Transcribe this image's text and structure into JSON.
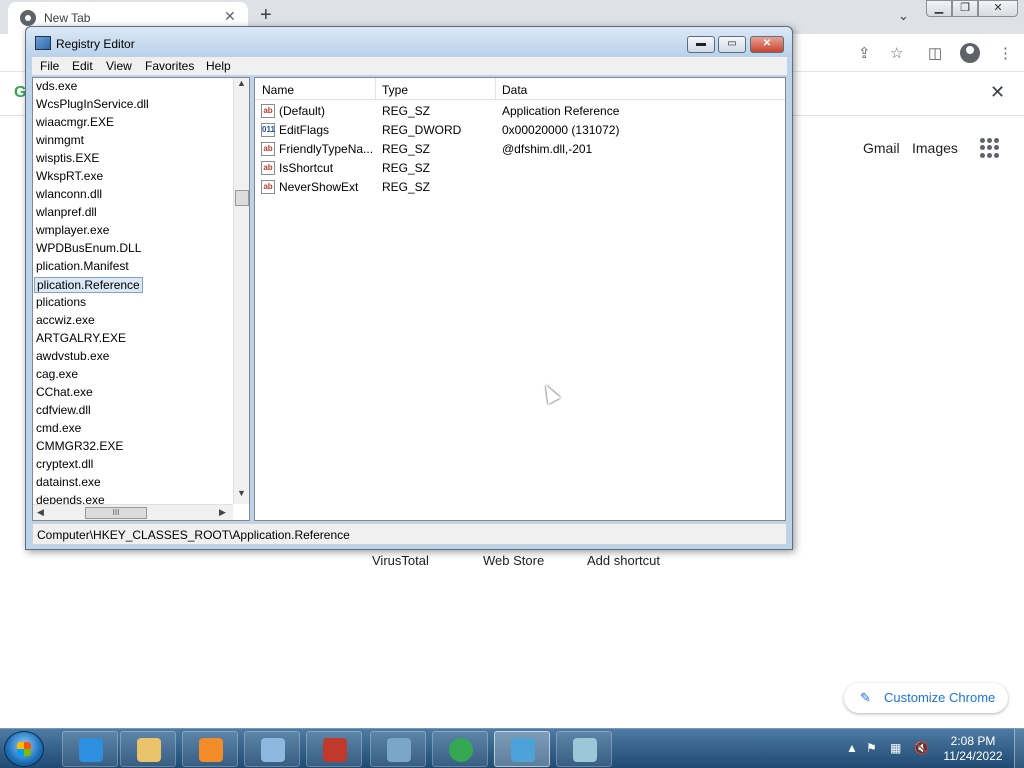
{
  "chrome": {
    "tab_title": "New Tab",
    "tab_close": "✕",
    "new_tab": "+",
    "tab_search": "⌄",
    "win_min": "▁",
    "win_max": "❐",
    "win_close": "✕",
    "share": "⇪",
    "star": "☆",
    "side_panel": "◫",
    "menu": "⋮",
    "infobar_logo": "G",
    "infobar_close": "✕",
    "links": {
      "gmail": "Gmail",
      "images": "Images"
    },
    "shortcuts": [
      "VirusTotal",
      "Web Store",
      "Add shortcut"
    ],
    "customize_label": "Customize Chrome",
    "customize_icon": "✎"
  },
  "regedit": {
    "title": "Registry Editor",
    "buttons": {
      "min": "▬",
      "max": "▭",
      "close": "✕"
    },
    "menu": [
      "File",
      "Edit",
      "View",
      "Favorites",
      "Help"
    ],
    "tree": [
      "vds.exe",
      "WcsPlugInService.dll",
      "wiaacmgr.EXE",
      "winmgmt",
      "wisptis.EXE",
      "WkspRT.exe",
      "wlanconn.dll",
      "wlanpref.dll",
      "wmplayer.exe",
      "WPDBusEnum.DLL",
      "plication.Manifest",
      "plication.Reference",
      "plications",
      "accwiz.exe",
      "ARTGALRY.EXE",
      "awdvstub.exe",
      "cag.exe",
      "CChat.exe",
      "cdfview.dll",
      "cmd.exe",
      "CMMGR32.EXE",
      "cryptext.dll",
      "datainst.exe",
      "depends.exe"
    ],
    "tree_selected_index": 11,
    "scroll": {
      "up": "▲",
      "down": "▼",
      "left": "◀",
      "right": "▶",
      "grip": "III"
    },
    "columns": [
      "Name",
      "Type",
      "Data"
    ],
    "rows": [
      {
        "icon": "ab",
        "name": "(Default)",
        "type": "REG_SZ",
        "data": "Application Reference"
      },
      {
        "icon": "011",
        "name": "EditFlags",
        "type": "REG_DWORD",
        "data": "0x00020000 (131072)"
      },
      {
        "icon": "ab",
        "name": "FriendlyTypeNa...",
        "type": "REG_SZ",
        "data": "@dfshim.dll,-201"
      },
      {
        "icon": "ab",
        "name": "IsShortcut",
        "type": "REG_SZ",
        "data": ""
      },
      {
        "icon": "ab",
        "name": "NeverShowExt",
        "type": "REG_SZ",
        "data": ""
      }
    ],
    "status": "Computer\\HKEY_CLASSES_ROOT\\Application.Reference"
  },
  "taskbar": {
    "apps": [
      {
        "name": "internet-explorer",
        "color": "#2d8fe0"
      },
      {
        "name": "file-explorer",
        "color": "#e9c46a"
      },
      {
        "name": "media-player",
        "color": "#f28c28"
      },
      {
        "name": "control-panel",
        "color": "#8fb8e0"
      },
      {
        "name": "toolbox",
        "color": "#c0392b"
      },
      {
        "name": "picture-viewer",
        "color": "#7aa6c9"
      },
      {
        "name": "chrome",
        "color": "#34a853"
      },
      {
        "name": "registry-editor",
        "color": "#4da3d9"
      },
      {
        "name": "notepad",
        "color": "#9cc7d8"
      }
    ],
    "tray": {
      "up": "▲",
      "flag": "⚑",
      "network": "▦",
      "volume": "🔇"
    },
    "time": "2:08 PM",
    "date": "11/24/2022"
  }
}
